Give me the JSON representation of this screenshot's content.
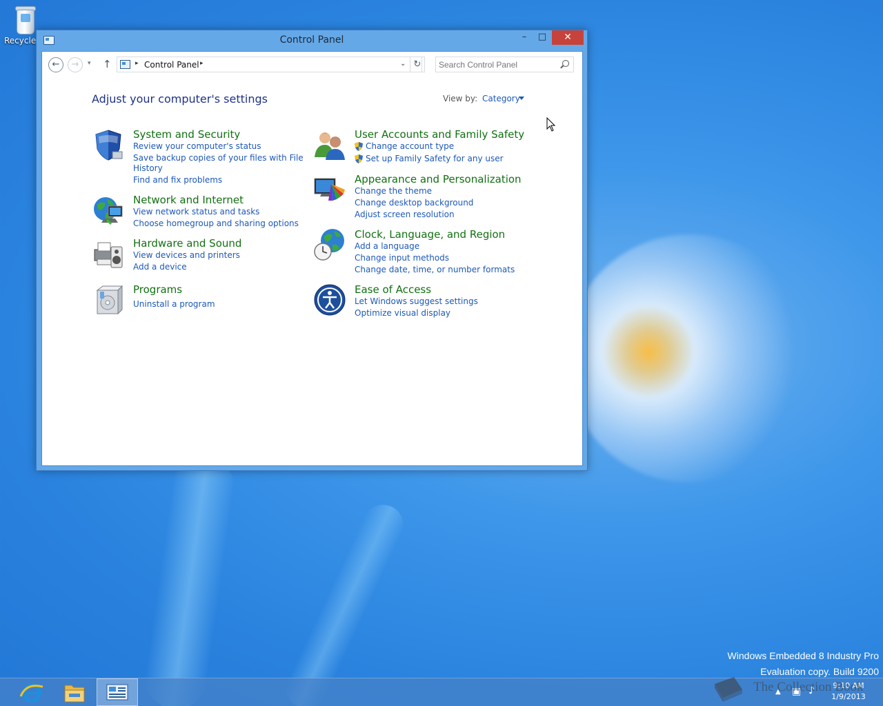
{
  "desktop": {
    "recycle_bin_label": "Recycle Bin"
  },
  "window": {
    "title": "Control Panel",
    "minimize_glyph": "–",
    "maximize_glyph": "□",
    "close_glyph": "✕"
  },
  "navbar": {
    "back_glyph": "←",
    "forward_glyph": "→",
    "recent_glyph": "▾",
    "up_glyph": "↑",
    "breadcrumb": "Control Panel",
    "crumb_sep": "▸",
    "dropdown_glyph": "⌄",
    "refresh_glyph": "↻",
    "search_placeholder": "Search Control Panel"
  },
  "main": {
    "heading": "Adjust your computer's settings",
    "view_by_label": "View by:",
    "view_by_value": "Category"
  },
  "categories_left": [
    {
      "title": "System and Security",
      "links": [
        "Review your computer's status",
        "Save backup copies of your files with File",
        "History",
        "Find and fix problems"
      ]
    },
    {
      "title": "Network and Internet",
      "links": [
        "View network status and tasks",
        "Choose homegroup and sharing options"
      ]
    },
    {
      "title": "Hardware and Sound",
      "links": [
        "View devices and printers",
        "Add a device"
      ]
    },
    {
      "title": "Programs",
      "links": [
        "Uninstall a program"
      ]
    }
  ],
  "categories_right": [
    {
      "title": "User Accounts and Family Safety",
      "links": [
        "Change account type",
        "Set up Family Safety for any user"
      ]
    },
    {
      "title": "Appearance and Personalization",
      "links": [
        "Change the theme",
        "Change desktop background",
        "Adjust screen resolution"
      ]
    },
    {
      "title": "Clock, Language, and Region",
      "links": [
        "Add a language",
        "Change input methods",
        "Change date, time, or number formats"
      ]
    },
    {
      "title": "Ease of Access",
      "links": [
        "Let Windows suggest settings",
        "Optimize visual display"
      ]
    }
  ],
  "watermark": {
    "line1": "Windows Embedded 8 Industry Pro",
    "line2": "Evaluation copy. Build 9200"
  },
  "taskbar": {
    "time": "9:10 AM",
    "date": "1/9/2013",
    "tray_up_glyph": "▲",
    "tray_net_glyph": "▣",
    "tray_vol_glyph": "♪"
  },
  "brand_overlay": "The Collection Book",
  "colors": {
    "category_title": "#117011",
    "link": "#1c58b8",
    "heading": "#1e3287",
    "close_button": "#c7423a"
  }
}
